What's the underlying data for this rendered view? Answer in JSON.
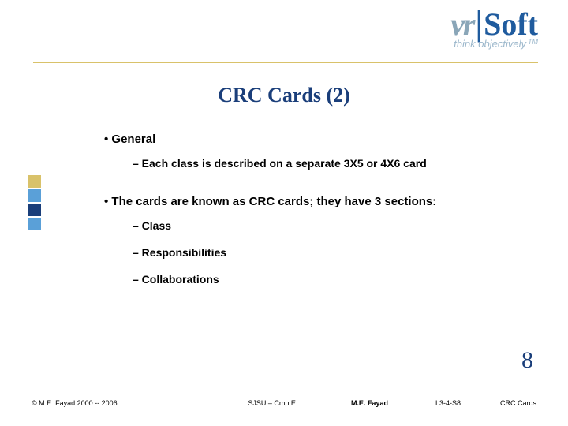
{
  "logo": {
    "vr": "vr",
    "bar": "|",
    "soft": "Soft",
    "tagline": "think objectively",
    "tm": "TM"
  },
  "title": "CRC Cards (2)",
  "bullets": {
    "b1a": "• General",
    "b2a": "– Each class is described on a separate 3X5 or 4X6 card",
    "b1b": "• The cards are known as CRC cards; they have 3 sections:",
    "b2b": "– Class",
    "b2c": "– Responsibilities",
    "b2d": "– Collaborations"
  },
  "page_number": "8",
  "footer": {
    "copyright": "© M.E. Fayad 2000 -- 2006",
    "school": "SJSU – Cmp.E",
    "author": "M.E. Fayad",
    "code": "L3-4-S8",
    "topic": "CRC Cards"
  },
  "deco_colors": [
    "#d9c26a",
    "#5aa0d8",
    "#1a3e7a",
    "#5aa0d8"
  ]
}
